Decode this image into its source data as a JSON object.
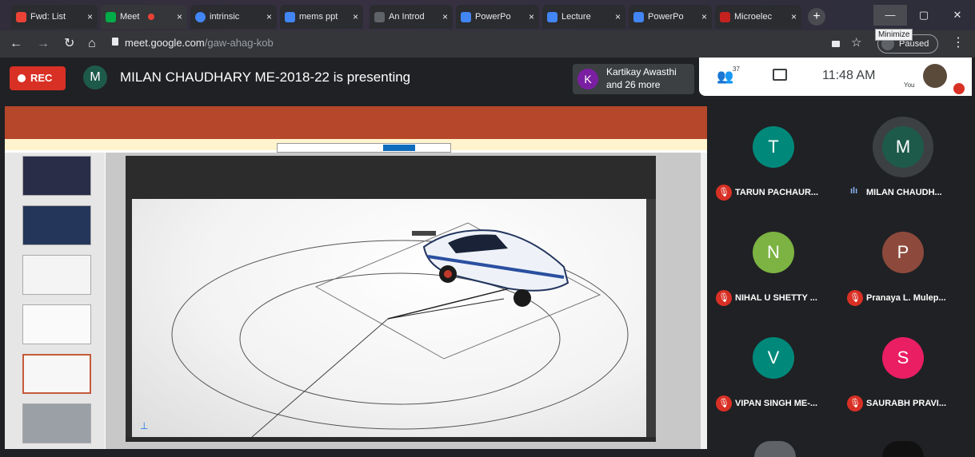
{
  "browser": {
    "tabs": [
      {
        "label": "Fwd: List",
        "color": "#ea4335",
        "icon": "gmail-icon"
      },
      {
        "label": "Meet",
        "color": "#00ac47",
        "icon": "meet-icon"
      },
      {
        "label": "intrinsic",
        "color": "#4285f4",
        "icon": "google-icon"
      },
      {
        "label": "mems ppt",
        "color": "#4285f4",
        "icon": "slides-icon"
      },
      {
        "label": "An Introd",
        "color": "#5f6368",
        "icon": "page-icon"
      },
      {
        "label": "PowerPo",
        "color": "#4285f4",
        "icon": "docs-icon"
      },
      {
        "label": "Lecture",
        "color": "#4285f4",
        "icon": "docs-icon"
      },
      {
        "label": "PowerPo",
        "color": "#4285f4",
        "icon": "docs-icon"
      },
      {
        "label": "Microelec",
        "color": "#c5221f",
        "icon": "page-icon"
      }
    ],
    "close_glyph": "×",
    "new_tab_glyph": "+",
    "minimize_glyph": "—",
    "maximize_glyph": "▢",
    "close_window_glyph": "✕",
    "tooltip": "Minimize",
    "url_host": "meet.google.com",
    "url_path": "/gaw-ahag-kob",
    "paused_label": "Paused"
  },
  "meet": {
    "rec_label": "REC",
    "presenter_initial": "M",
    "presenter_color": "#1e5a4a",
    "presenting_text": "MILAN CHAUDHARY ME-2018-22 is presenting",
    "viewer_initial": "K",
    "viewer_color": "#7b1fa2",
    "viewer_line1": "Kartikay Awasthi",
    "viewer_line2": "and 26 more",
    "participants_count": "37",
    "time": "11:48 AM",
    "you_label": "You"
  },
  "participants": [
    {
      "initial": "T",
      "name": "TARUN PACHAUR...",
      "color": "#00897b",
      "muted": true
    },
    {
      "initial": "M",
      "name": "MILAN CHAUDH...",
      "color": "#1e5a4a",
      "muted": false
    },
    {
      "initial": "N",
      "name": "NIHAL U SHETTY ...",
      "color": "#7cb342",
      "muted": true
    },
    {
      "initial": "P",
      "name": "Pranaya L. Mulep...",
      "color": "#8d4a3c",
      "muted": true
    },
    {
      "initial": "V",
      "name": "VIPAN SINGH ME-...",
      "color": "#00897b",
      "muted": true
    },
    {
      "initial": "S",
      "name": "SAURABH PRAVI...",
      "color": "#e91e63",
      "muted": true
    }
  ],
  "colors": {
    "accent": "#d93025",
    "powerpoint": "#b7472a"
  }
}
